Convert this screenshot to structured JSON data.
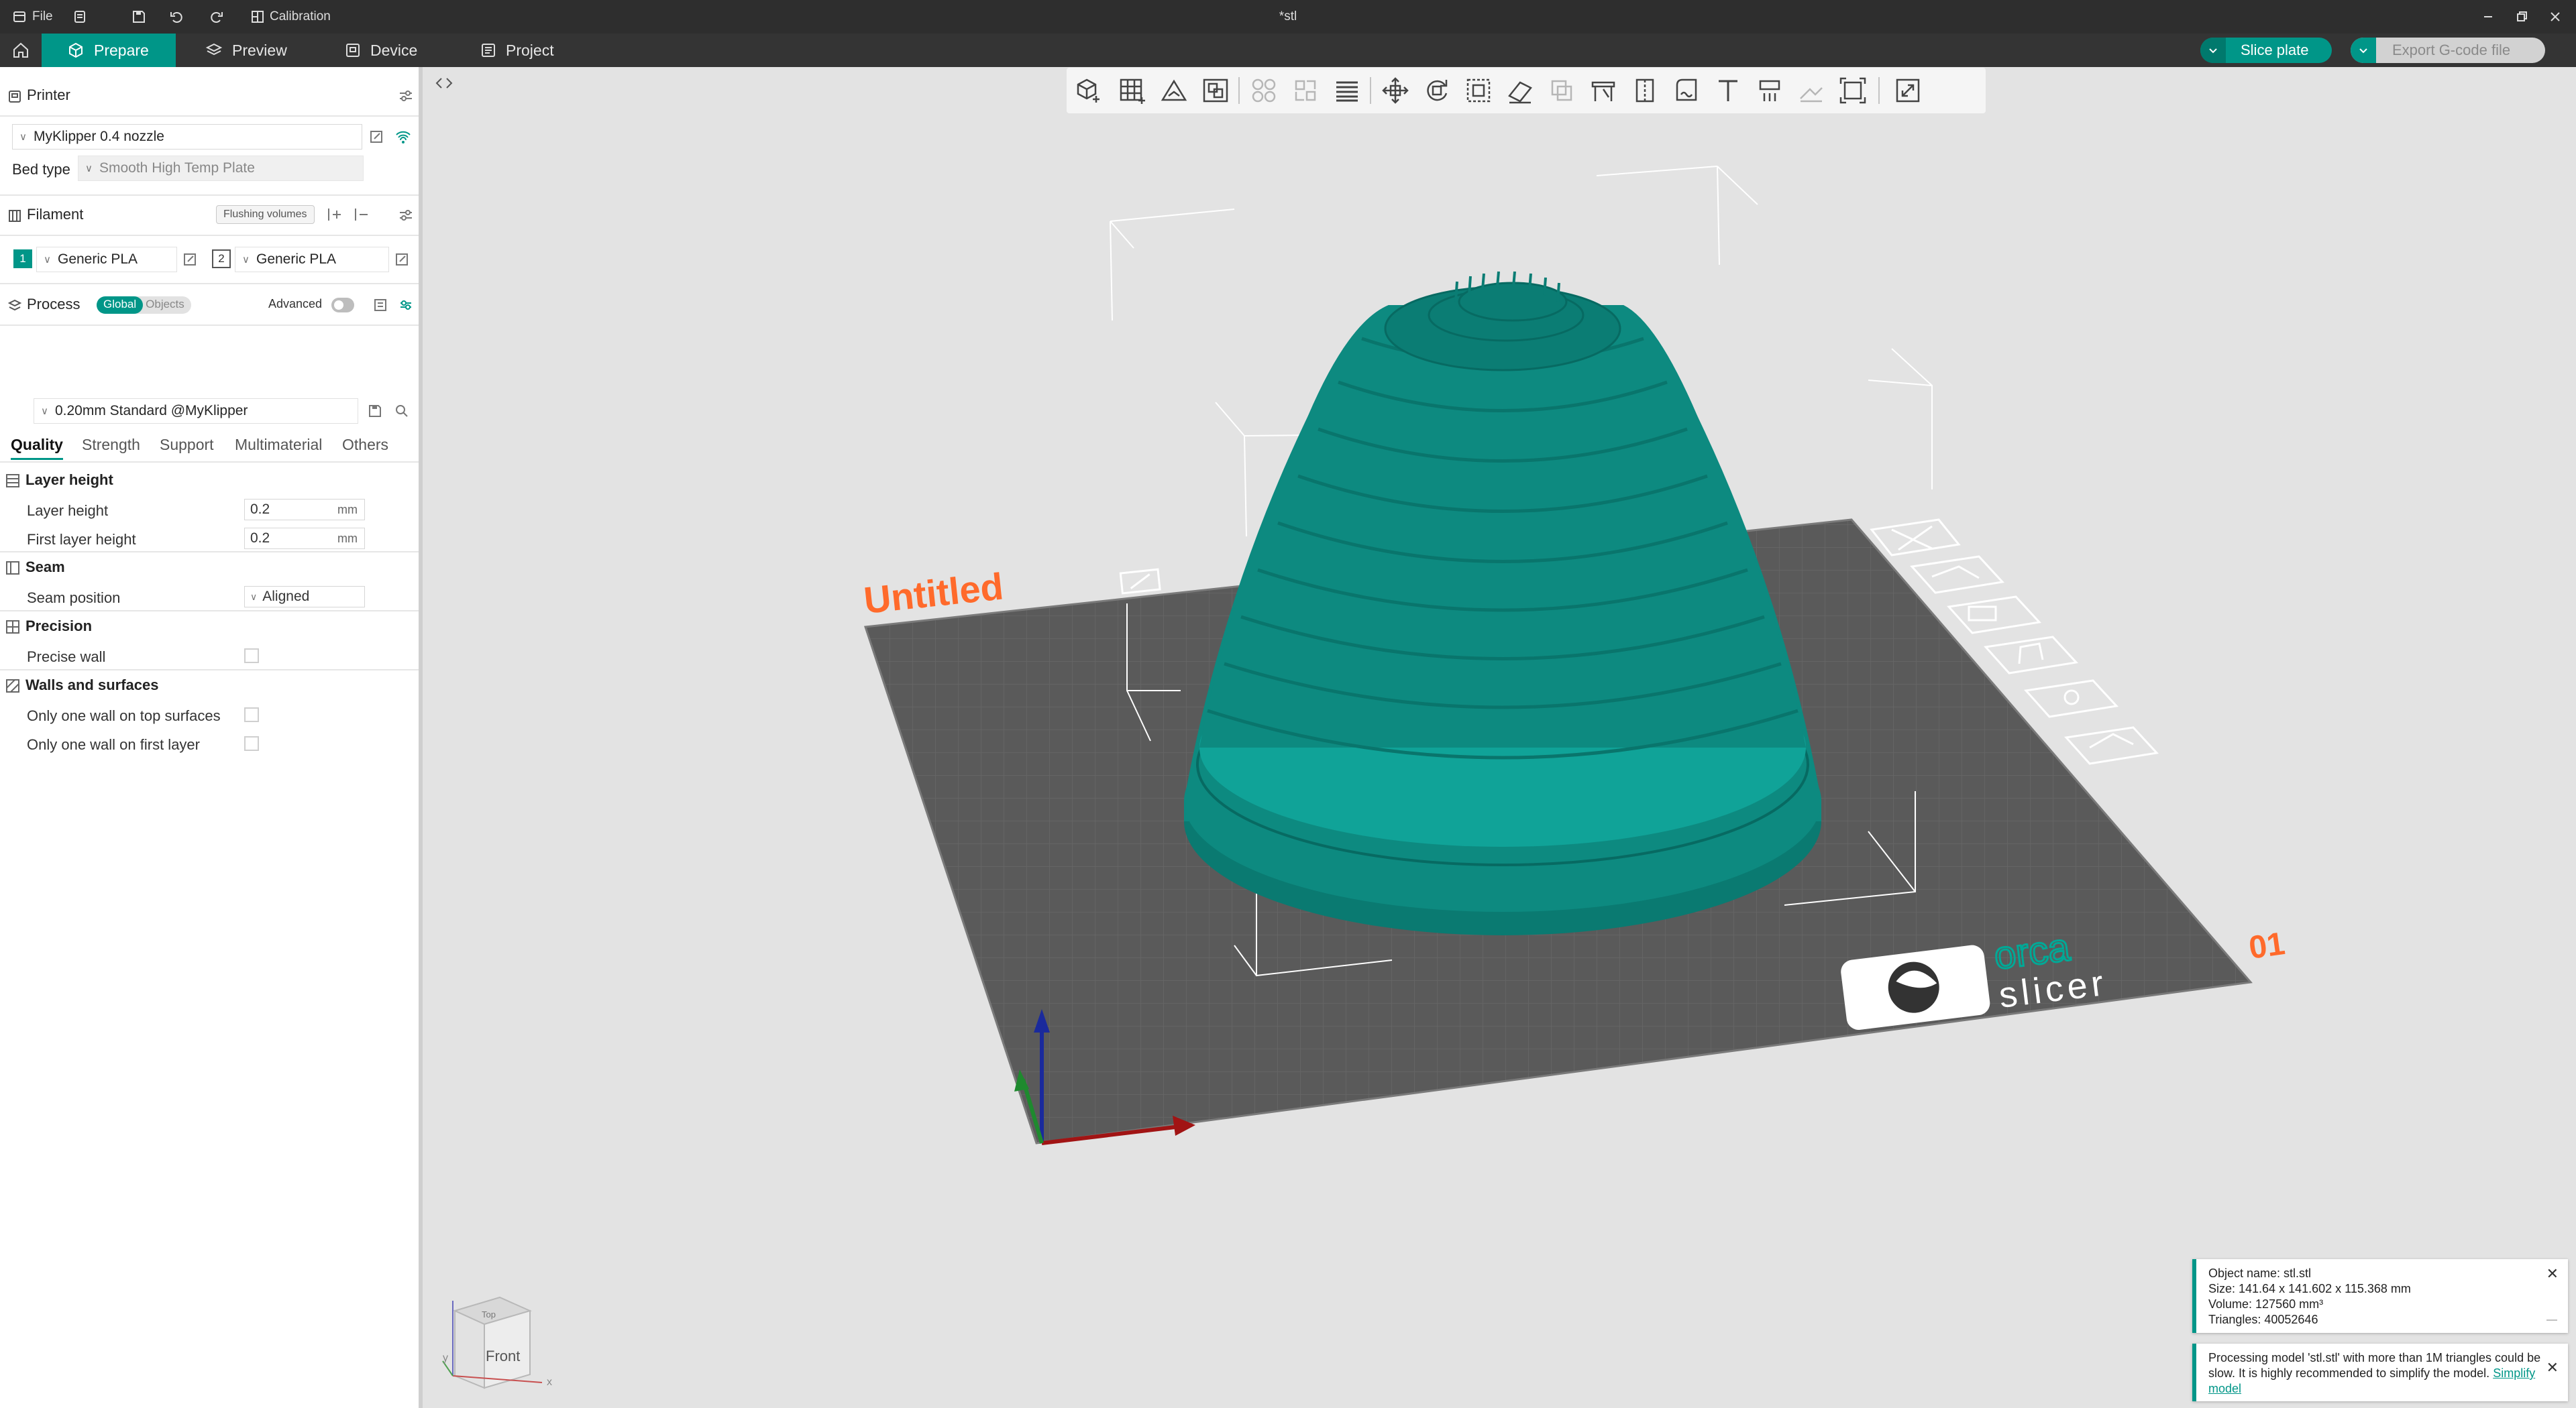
{
  "colors": {
    "accent": "#009688",
    "titlebar": "#2e2e2e",
    "tabbar": "#343434",
    "plate": "#5a5a5a",
    "model": "#0d8a80",
    "brand_orange": "#ff6a2b"
  },
  "titlebar": {
    "file_label": "File",
    "calibration_label": "Calibration",
    "window_title": "*stl"
  },
  "tabs": [
    {
      "label": "Prepare",
      "icon": "cube-icon"
    },
    {
      "label": "Preview",
      "icon": "layers-icon"
    },
    {
      "label": "Device",
      "icon": "device-icon"
    },
    {
      "label": "Project",
      "icon": "project-icon"
    }
  ],
  "actions": {
    "slice_label": "Slice plate",
    "export_label": "Export G-code file"
  },
  "printer": {
    "section_label": "Printer",
    "selected": "MyKlipper 0.4 nozzle",
    "bed_type_label": "Bed type",
    "bed_type_value": "Smooth High Temp Plate"
  },
  "filament": {
    "section_label": "Filament",
    "flushing_label": "Flushing volumes",
    "slots": [
      {
        "index": "1",
        "name": "Generic PLA",
        "color": "#009688"
      },
      {
        "index": "2",
        "name": "Generic PLA",
        "color": "#ffffff"
      }
    ]
  },
  "process": {
    "section_label": "Process",
    "global_label": "Global",
    "objects_label": "Objects",
    "advanced_label": "Advanced",
    "preset": "0.20mm Standard @MyKlipper",
    "tabs": [
      "Quality",
      "Strength",
      "Support",
      "Multimaterial",
      "Others"
    ],
    "groups": {
      "layer_height": {
        "title": "Layer height",
        "layer_height_label": "Layer height",
        "layer_height_value": "0.2",
        "first_layer_label": "First layer height",
        "first_layer_value": "0.2",
        "unit": "mm"
      },
      "seam": {
        "title": "Seam",
        "position_label": "Seam position",
        "position_value": "Aligned"
      },
      "precision": {
        "title": "Precision",
        "precise_wall_label": "Precise wall"
      },
      "walls": {
        "title": "Walls and surfaces",
        "top_label": "Only one wall on top surfaces",
        "first_label": "Only one wall on first layer"
      }
    }
  },
  "plate": {
    "name": "Untitled",
    "number": "01",
    "brand_top": "orca",
    "brand_bottom": "slicer"
  },
  "view_cube": {
    "face_label": "Front",
    "top_label": "Top",
    "axis_x": "x",
    "axis_y": "y"
  },
  "notifications": {
    "object_name": "Object name: stl.stl",
    "size": "Size: 141.64 x 141.602 x 115.368 mm",
    "volume": "Volume: 127560 mm³",
    "triangles": "Triangles: 40052646",
    "warning_text": "Processing model 'stl.stl' with more than 1M triangles could be slow. It is highly recommended to simplify the model.",
    "warning_link": "Simplify model"
  }
}
